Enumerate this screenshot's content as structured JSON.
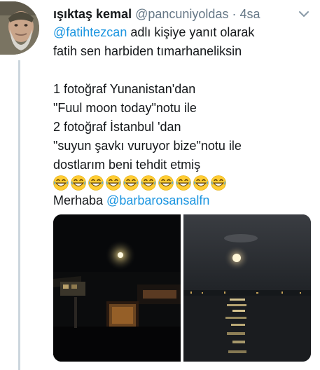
{
  "tweet": {
    "author": {
      "display_name": "ışıktaş kemal",
      "handle": "@pancuniyoldas",
      "separator": "·",
      "time": "4sa"
    },
    "reply_to": {
      "mention": "@fatihtezcan",
      "suffix": " adlı kişiye yanıt olarak"
    },
    "text_lines": [
      "fatih sen harbiden tımarhaneliksin",
      "",
      "1 fotoğraf Yunanistan'dan",
      "\"Fuul moon today\"notu ile",
      "2 fotoğraf İstanbul 'dan",
      "\"suyun şavkı vuruyor bize\"notu ile",
      "dostlarım beni tehdit etmiş"
    ],
    "emoji": {
      "name": "laughing-face-emoji",
      "count": 10
    },
    "closing": {
      "text": "Merhaba ",
      "mention": "@barbarosansalfn"
    }
  },
  "colors": {
    "text": "#14171a",
    "secondary": "#657786",
    "link": "#1b95e0",
    "thread_line": "#ccd6dd"
  },
  "media": {
    "photos": [
      {
        "name": "night-moon-photo-greece"
      },
      {
        "name": "moonlight-on-water-photo-istanbul"
      }
    ]
  }
}
